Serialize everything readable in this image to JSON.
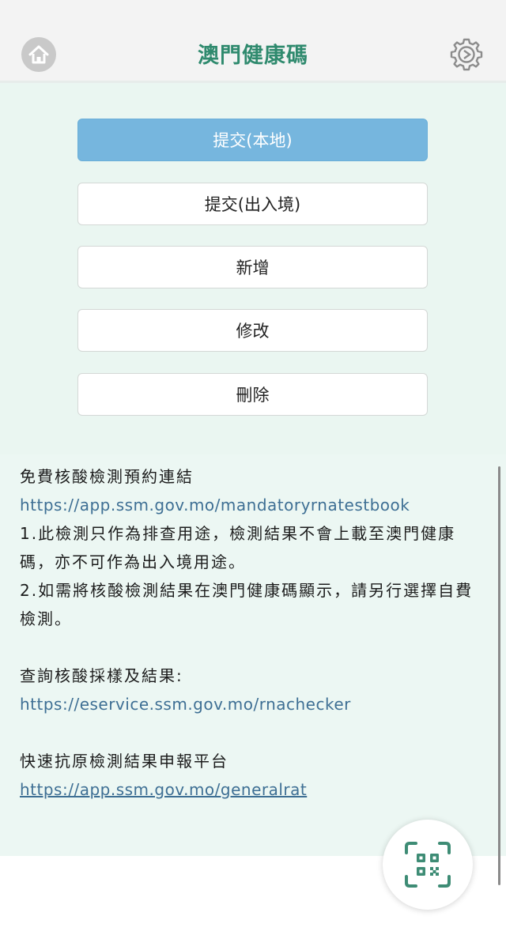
{
  "header": {
    "title": "澳門健康碼",
    "home_icon": "home-icon",
    "settings_icon": "gear-icon"
  },
  "buttons": {
    "submit_local": "提交(本地)",
    "submit_border": "提交(出入境)",
    "add": "新增",
    "edit": "修改",
    "delete": "刪除"
  },
  "info": {
    "booking_heading": "免費核酸檢測預約連結",
    "booking_link": "https://app.ssm.gov.mo/mandatoryrnatestbook",
    "note1": "1.此檢測只作為排查用途，檢測結果不會上載至澳門健康碼，亦不可作為出入境用途。",
    "note2": "2.如需將核酸檢測結果在澳門健康碼顯示，請另行選擇自費檢測。",
    "query_heading": "查詢核酸採樣及結果:",
    "query_link": "https://eservice.ssm.gov.mo/rnachecker",
    "rat_heading": "快速抗原檢測結果申報平台",
    "rat_link": "https://app.ssm.gov.mo/generalrat"
  },
  "fab": {
    "icon": "qr-code-scan-icon"
  },
  "colors": {
    "brand": "#2f8a6e",
    "primary_button": "#76b6de",
    "link": "#3e6f94",
    "background": "#eaf6f1"
  }
}
